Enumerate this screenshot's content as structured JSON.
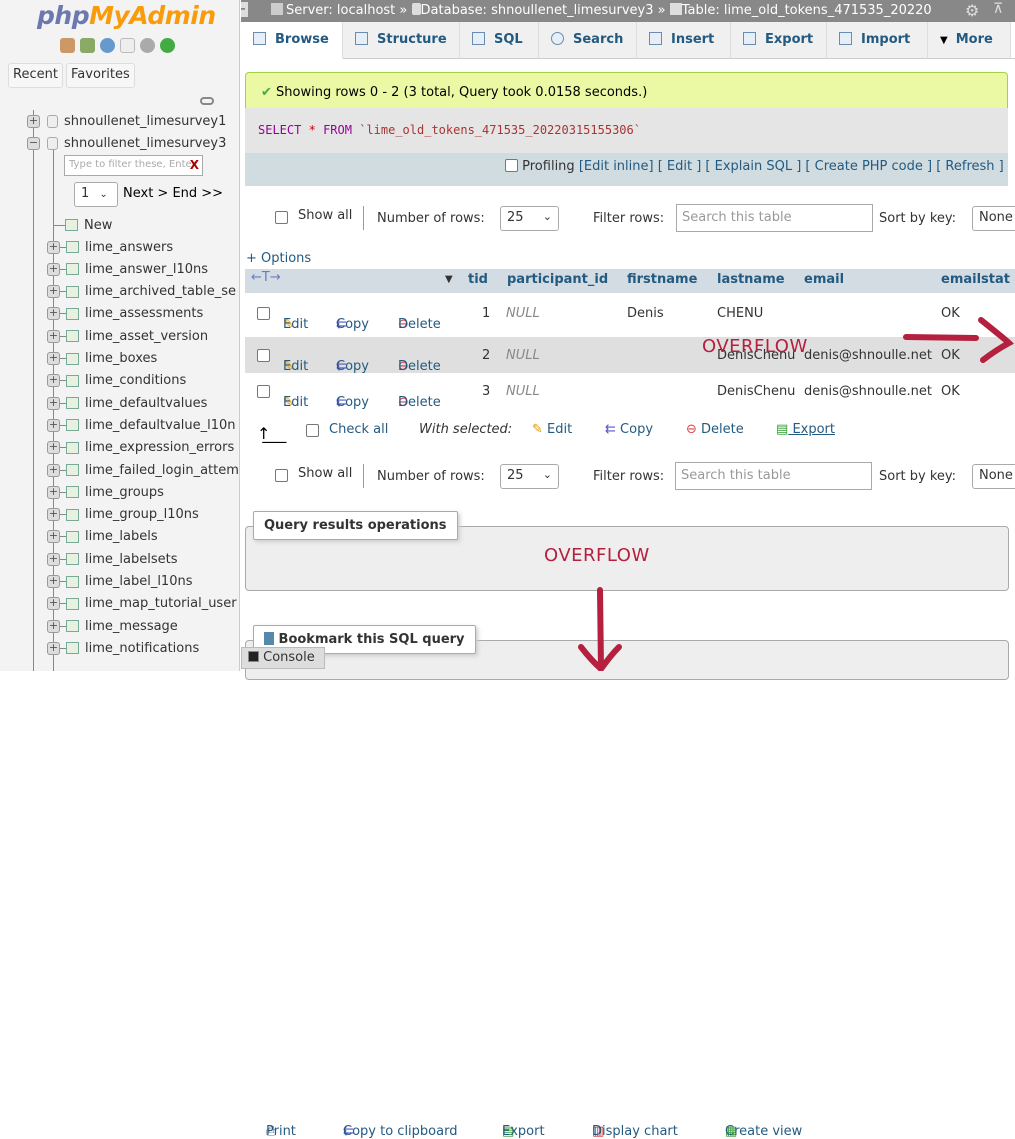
{
  "sidebar": {
    "logo": "phpMyAdmin",
    "logo_php": "php",
    "logo_ma": "MyAdmin",
    "recent": "Recent",
    "favorites": "Favorites",
    "databases": [
      "shnoullenet_limesurvey1",
      "shnoullenet_limesurvey3"
    ],
    "filter_placeholder": "Type to filter these, Enter",
    "filter_clear": "X",
    "page_select": "1",
    "page_nav": "Next > End >>",
    "new_label": "New",
    "tables": [
      "lime_answers",
      "lime_answer_l10ns",
      "lime_archived_table_se",
      "lime_assessments",
      "lime_asset_version",
      "lime_boxes",
      "lime_conditions",
      "lime_defaultvalues",
      "lime_defaultvalue_l10n",
      "lime_expression_errors",
      "lime_failed_login_attem",
      "lime_groups",
      "lime_group_l10ns",
      "lime_labels",
      "lime_labelsets",
      "lime_label_l10ns",
      "lime_map_tutorial_user",
      "lime_message",
      "lime_notifications"
    ]
  },
  "breadcrumb": {
    "server": "Server: localhost",
    "sep": "»",
    "database": "Database: shnoullenet_limesurvey3",
    "table": "Table: lime_old_tokens_471535_20220"
  },
  "tabs": [
    "Browse",
    "Structure",
    "SQL",
    "Search",
    "Insert",
    "Export",
    "Import",
    "More"
  ],
  "message": "Showing rows 0 - 2 (3 total, Query took 0.0158 seconds.)",
  "sql": {
    "select": "SELECT",
    "star": "*",
    "from": "FROM",
    "table": "`lime_old_tokens_471535_20220315155306`"
  },
  "sql_options": {
    "profiling": "Profiling",
    "links": "[Edit inline] [ Edit ] [ Explain SQL ] [ Create PHP code ] [ Refresh ]"
  },
  "nav": {
    "show_all": "Show all",
    "rows_label": "Number of rows:",
    "rows_value": "25",
    "filter_label": "Filter rows:",
    "filter_placeholder": "Search this table",
    "sort_label": "Sort by key:",
    "sort_value": "None"
  },
  "options_link": "+ Options",
  "columns": [
    "tid",
    "participant_id",
    "firstname",
    "lastname",
    "email",
    "emailstat"
  ],
  "row_actions": {
    "edit": "Edit",
    "copy": "Copy",
    "delete": "Delete"
  },
  "rows": [
    {
      "tid": "1",
      "participant_id": "NULL",
      "firstname": "Denis",
      "lastname": "CHENU",
      "email": "",
      "emailstatus": "OK"
    },
    {
      "tid": "2",
      "participant_id": "NULL",
      "firstname": "",
      "lastname": "DenisChenu",
      "email": "denis@shnoulle.net",
      "emailstatus": "OK"
    },
    {
      "tid": "3",
      "participant_id": "NULL",
      "firstname": "",
      "lastname": "DenisChenu",
      "email": "denis@shnoulle.net",
      "emailstatus": "OK"
    }
  ],
  "bulk": {
    "check_all": "Check all",
    "with_selected": "With selected:",
    "edit": "Edit",
    "copy": "Copy",
    "delete": "Delete",
    "export": "Export"
  },
  "ops": {
    "legend": "Query results operations",
    "print": "Print",
    "copy_clipboard": "Copy to clipboard",
    "export": "Export",
    "display_chart": "Display chart",
    "create_view": "Create view"
  },
  "bookmark": "Bookmark this SQL query",
  "console": "Console",
  "annotations": {
    "overflow": "OVERFLOW"
  },
  "colors": {
    "link": "#235a81",
    "annotation": "#b5203f",
    "success_bg": "#ebf8a4"
  }
}
